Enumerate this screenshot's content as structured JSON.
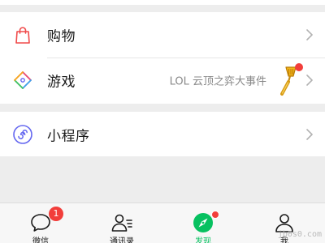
{
  "menu": {
    "shopping": {
      "label": "购物",
      "icon": "shopping-bag-icon"
    },
    "games": {
      "label": "游戏",
      "subtitle": "LOL 云顶之弈大事件",
      "has_new": true,
      "icon": "games-icon"
    },
    "mini_programs": {
      "label": "小程序",
      "icon": "mini-program-icon"
    }
  },
  "tabbar": {
    "tabs": [
      {
        "label": "微信",
        "icon": "chat-icon",
        "badge": "1"
      },
      {
        "label": "通讯录",
        "icon": "contacts-icon"
      },
      {
        "label": "发现",
        "icon": "discover-icon",
        "active": true,
        "has_new": true
      },
      {
        "label": "我",
        "icon": "me-icon"
      }
    ]
  },
  "watermark": "jb0s0.com",
  "colors": {
    "accent": "#07c160",
    "badge": "#f23e3b",
    "background": "#ededed",
    "shopping_icon": "#f04a4a",
    "mini_program_icon": "#6467f0"
  }
}
